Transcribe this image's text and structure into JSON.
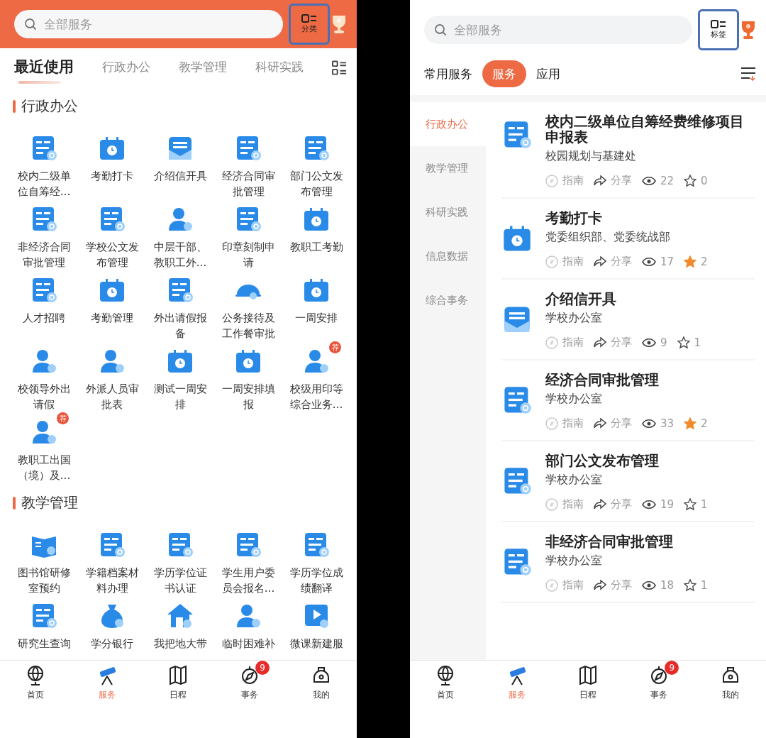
{
  "left_screen": {
    "search": {
      "placeholder": "全部服务"
    },
    "view_button": {
      "label": "分类",
      "highlighted": true
    },
    "tabs": [
      {
        "label": "最近使用",
        "selected": true
      },
      {
        "label": "行政办公",
        "selected": false
      },
      {
        "label": "教学管理",
        "selected": false
      },
      {
        "label": "科研实践",
        "selected": false
      }
    ],
    "sections": [
      {
        "title": "行政办公",
        "items": [
          {
            "label": "校内二级单位自筹经..."
          },
          {
            "label": "考勤打卡"
          },
          {
            "label": "介绍信开具"
          },
          {
            "label": "经济合同审批管理"
          },
          {
            "label": "部门公文发布管理"
          },
          {
            "label": "非经济合同审批管理"
          },
          {
            "label": "学校公文发布管理"
          },
          {
            "label": "中层干部、教职工外..."
          },
          {
            "label": "印章刻制申请"
          },
          {
            "label": "教职工考勤"
          },
          {
            "label": "人才招聘"
          },
          {
            "label": "考勤管理"
          },
          {
            "label": "外出请假报备"
          },
          {
            "label": "公务接待及工作餐审批"
          },
          {
            "label": "一周安排"
          },
          {
            "label": "校领导外出请假"
          },
          {
            "label": "外派人员审批表"
          },
          {
            "label": "测试一周安排"
          },
          {
            "label": "一周安排填报"
          },
          {
            "label": "校级用印等综合业务...",
            "badge": "荐"
          },
          {
            "label": "教职工出国（境）及...",
            "badge": "荐"
          }
        ]
      },
      {
        "title": "教学管理",
        "items": [
          {
            "label": "图书馆研修室预约"
          },
          {
            "label": "学籍档案材料办理"
          },
          {
            "label": "学历学位证书认证"
          },
          {
            "label": "学生用户委员会报名..."
          },
          {
            "label": "学历学位成绩翻译"
          },
          {
            "label": "研究生查询"
          },
          {
            "label": "学分银行"
          },
          {
            "label": "我把地大带"
          },
          {
            "label": "临时困难补"
          },
          {
            "label": "微课新建服"
          }
        ]
      }
    ],
    "bottom_nav": [
      {
        "label": "首页",
        "selected": false
      },
      {
        "label": "服务",
        "selected": true
      },
      {
        "label": "日程",
        "selected": false
      },
      {
        "label": "事务",
        "selected": false,
        "badge": "9"
      },
      {
        "label": "我的",
        "selected": false
      }
    ]
  },
  "right_screen": {
    "search": {
      "placeholder": "全部服务"
    },
    "view_button": {
      "label": "标签",
      "highlighted": true
    },
    "tabs": [
      {
        "label": "常用服务",
        "selected": false
      },
      {
        "label": "服务",
        "selected": true
      },
      {
        "label": "应用",
        "selected": false
      }
    ],
    "sidebar": [
      {
        "label": "行政办公",
        "selected": true
      },
      {
        "label": "教学管理",
        "selected": false
      },
      {
        "label": "科研实践",
        "selected": false
      },
      {
        "label": "信息数据",
        "selected": false
      },
      {
        "label": "综合事务",
        "selected": false
      }
    ],
    "services": [
      {
        "title": "校内二级单位自筹经费维修项目申报表",
        "department": "校园规划与基建处",
        "guide": "指南",
        "share": "分享",
        "views": "22",
        "stars": "0",
        "starred": false
      },
      {
        "title": "考勤打卡",
        "department": "党委组织部、党委统战部",
        "guide": "指南",
        "share": "分享",
        "views": "17",
        "stars": "2",
        "starred": true
      },
      {
        "title": "介绍信开具",
        "department": "学校办公室",
        "guide": "指南",
        "share": "分享",
        "views": "9",
        "stars": "1",
        "starred": false
      },
      {
        "title": "经济合同审批管理",
        "department": "学校办公室",
        "guide": "指南",
        "share": "分享",
        "views": "33",
        "stars": "2",
        "starred": true
      },
      {
        "title": "部门公文发布管理",
        "department": "学校办公室",
        "guide": "指南",
        "share": "分享",
        "views": "19",
        "stars": "1",
        "starred": false
      },
      {
        "title": "非经济合同审批管理",
        "department": "学校办公室",
        "guide": "指南",
        "share": "分享",
        "views": "18",
        "stars": "1",
        "starred": false
      }
    ],
    "bottom_nav": [
      {
        "label": "首页",
        "selected": false
      },
      {
        "label": "服务",
        "selected": true
      },
      {
        "label": "日程",
        "selected": false
      },
      {
        "label": "事务",
        "selected": false,
        "badge": "9"
      },
      {
        "label": "我的",
        "selected": false
      }
    ]
  }
}
